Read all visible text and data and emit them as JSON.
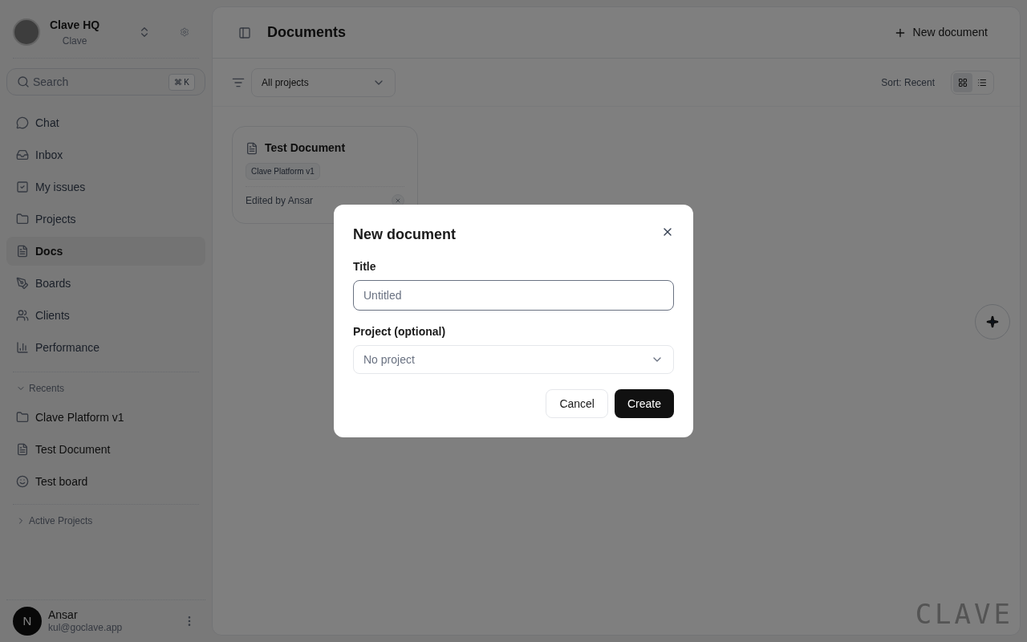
{
  "workspace": {
    "name": "Clave HQ",
    "subtitle": "Clave"
  },
  "search": {
    "placeholder": "Search",
    "shortcut": "⌘ K"
  },
  "nav": [
    {
      "label": "Chat",
      "kind": "chat",
      "selected": false
    },
    {
      "label": "Inbox",
      "kind": "inbox",
      "selected": false
    },
    {
      "label": "My issues",
      "kind": "check",
      "selected": false
    },
    {
      "label": "Projects",
      "kind": "folder",
      "selected": false
    },
    {
      "label": "Docs",
      "kind": "doc",
      "selected": true
    },
    {
      "label": "Boards",
      "kind": "pen",
      "selected": false
    },
    {
      "label": "Clients",
      "kind": "users",
      "selected": false
    },
    {
      "label": "Performance",
      "kind": "chart",
      "selected": false
    }
  ],
  "sections": [
    {
      "label": "Recents",
      "expanded": true,
      "items": [
        {
          "label": "Clave Platform v1",
          "kind": "folder"
        },
        {
          "label": "Test Document",
          "kind": "doc"
        },
        {
          "label": "Test board",
          "kind": "face"
        }
      ]
    },
    {
      "label": "Active Projects",
      "expanded": false
    }
  ],
  "user": {
    "initial": "N",
    "name": "Ansar",
    "email": "kul@goclave.app"
  },
  "header": {
    "title": "Documents",
    "action": "New document"
  },
  "filter": {
    "value": "All projects",
    "sort": "Sort: Recent",
    "view": [
      {
        "kind": "grid",
        "selected": true
      },
      {
        "kind": "list",
        "selected": false
      }
    ]
  },
  "documents": [
    {
      "title": "Test Document",
      "tag": "Clave Platform v1",
      "edited": "Edited by Ansar"
    }
  ],
  "brand_mark": "CLAVE",
  "dialog": {
    "title": "New document",
    "fields": [
      {
        "kind": "text",
        "label": "Title",
        "placeholder": "Untitled"
      },
      {
        "kind": "select",
        "label": "Project (optional)",
        "value": "No project"
      }
    ],
    "buttons": [
      {
        "label": "Cancel",
        "primary": false
      },
      {
        "label": "Create",
        "primary": true
      }
    ]
  }
}
